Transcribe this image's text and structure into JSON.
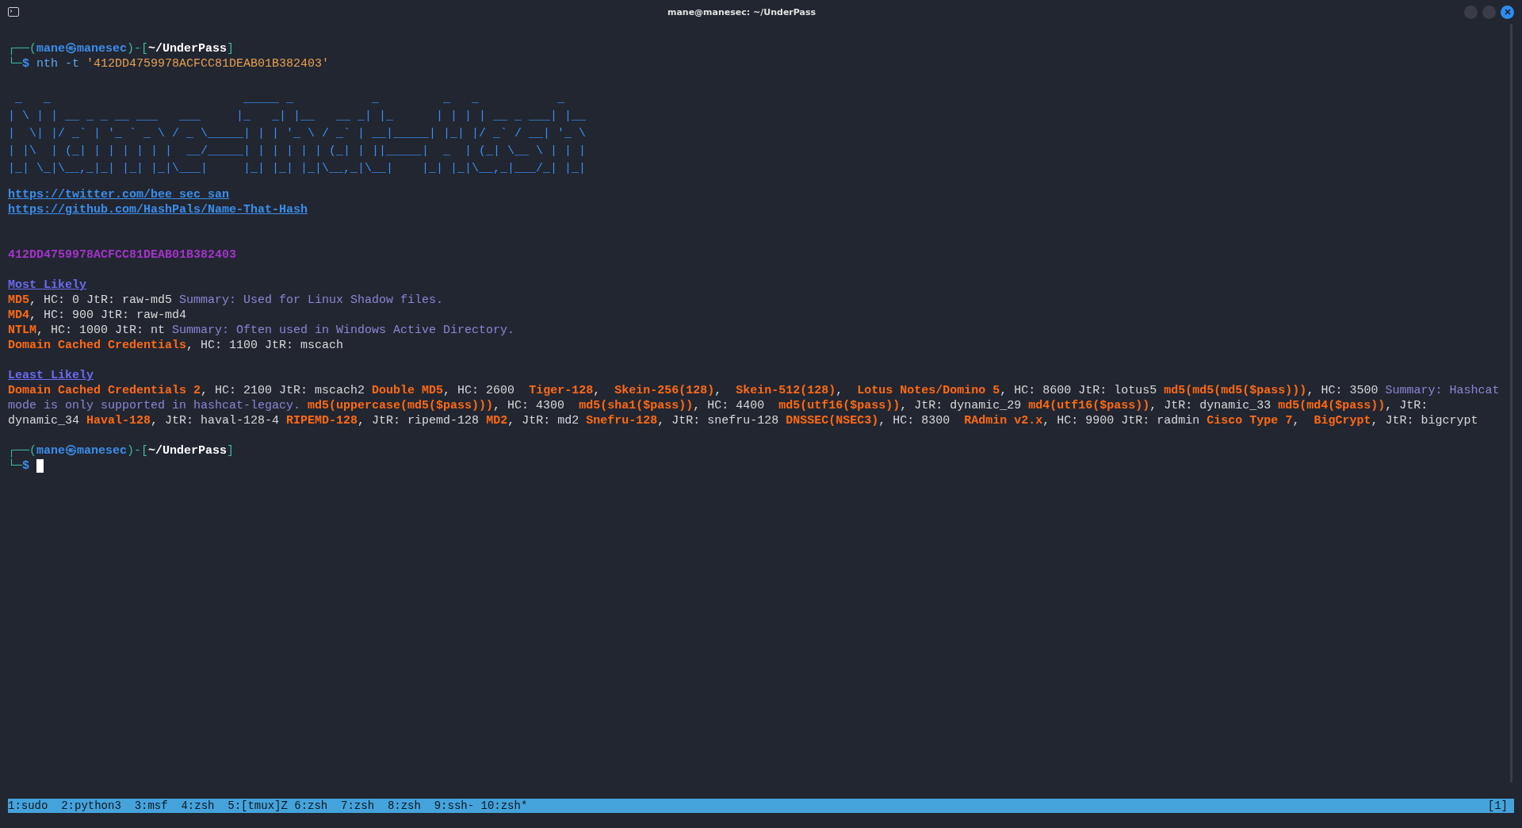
{
  "window": {
    "title": "mane@manesec: ~/UnderPass"
  },
  "terminal": [
    {
      "kind": "prompt",
      "lines": [
        [
          {
            "kind": "frame",
            "text": "┌──("
          },
          {
            "kind": "user",
            "text": "mane㉿manesec"
          },
          {
            "kind": "frame",
            "text": ")-["
          },
          {
            "kind": "path",
            "text": "~/UnderPass"
          },
          {
            "kind": "frame",
            "text": "]"
          }
        ],
        [
          {
            "kind": "frame",
            "text": "└─"
          },
          {
            "kind": "symbol",
            "text": "$"
          },
          {
            "kind": "command",
            "text": " nth -t "
          },
          {
            "kind": "argument",
            "text": "'412DD4759978ACFCC81DEAB01B382403'"
          }
        ]
      ]
    },
    {
      "kind": "art",
      "lines": [
        " _   _                           _____ _           _         _   _           _     ",
        "| \\ | | __ _ _ __ ___   ___     |_   _| |__   __ _| |_      | | | | __ _ ___| |__  ",
        "|  \\| |/ _` | '_ ` _ \\ / _ \\_____| | | '_ \\ / _` | __|_____| |_| |/ _` / __| '_ \\ ",
        "| |\\  | (_| | | | | | |  __/_____| | | | | | (_| | ||_____|  _  | (_| \\__ \\ | | |",
        "|_| \\_|\\__,_|_| |_| |_|\\___|     |_| |_| |_|\\__,_|\\__|    |_| |_|\\__,_|___/_| |_|"
      ]
    },
    {
      "kind": "links",
      "items": [
        "https://twitter.com/bee_sec_san",
        "https://github.com/HashPals/Name-That-Hash"
      ]
    },
    {
      "kind": "hash",
      "text": "412DD4759978ACFCC81DEAB01B382403"
    },
    {
      "kind": "section",
      "heading": "Most Likely",
      "results": [
        [
          {
            "kind": "name",
            "text": "MD5"
          },
          {
            "kind": "plain",
            "text": ", HC: 0 JtR: raw-md5 "
          },
          {
            "kind": "summary",
            "text": "Summary: Used for Linux Shadow files."
          }
        ],
        [
          {
            "kind": "name",
            "text": "MD4"
          },
          {
            "kind": "plain",
            "text": ", HC: 900 JtR: raw-md4"
          }
        ],
        [
          {
            "kind": "name",
            "text": "NTLM"
          },
          {
            "kind": "plain",
            "text": ", HC: 1000 JtR: nt "
          },
          {
            "kind": "summary",
            "text": "Summary: Often used in Windows Active Directory."
          }
        ],
        [
          {
            "kind": "name",
            "text": "Domain Cached Credentials"
          },
          {
            "kind": "plain",
            "text": ", HC: 1100 JtR: mscach"
          }
        ]
      ]
    },
    {
      "kind": "section",
      "heading": "Least Likely",
      "results": [
        [
          {
            "kind": "name",
            "text": "Domain Cached Credentials 2"
          },
          {
            "kind": "plain",
            "text": ", HC: 2100 JtR: mscach2 "
          },
          {
            "kind": "name",
            "text": "Double MD5"
          },
          {
            "kind": "plain",
            "text": ", HC: 2600  "
          },
          {
            "kind": "name",
            "text": "Tiger-128"
          },
          {
            "kind": "plain",
            "text": ",  "
          },
          {
            "kind": "name",
            "text": "Skein-256(128)"
          },
          {
            "kind": "plain",
            "text": ",  "
          },
          {
            "kind": "name",
            "text": "Skein-512(128)"
          },
          {
            "kind": "plain",
            "text": ",  "
          },
          {
            "kind": "name",
            "text": "Lotus Notes/Domino 5"
          },
          {
            "kind": "plain",
            "text": ", HC: 8600 JtR: lotus5 "
          },
          {
            "kind": "name",
            "text": "md5(md5(md5($pass)))"
          },
          {
            "kind": "plain",
            "text": ", HC: 3500 "
          },
          {
            "kind": "summary",
            "text": "Summary: Hashcat mode is only supported in hashcat-legacy. "
          },
          {
            "kind": "name",
            "text": "md5(uppercase(md5($pass)))"
          },
          {
            "kind": "plain",
            "text": ", HC: 4300  "
          },
          {
            "kind": "name",
            "text": "md5(sha1($pass))"
          },
          {
            "kind": "plain",
            "text": ", HC: 4400  "
          },
          {
            "kind": "name",
            "text": "md5(utf16($pass))"
          },
          {
            "kind": "plain",
            "text": ", JtR: dynamic_29 "
          },
          {
            "kind": "name",
            "text": "md4(utf16($pass))"
          },
          {
            "kind": "plain",
            "text": ", JtR: dynamic_33 "
          },
          {
            "kind": "name",
            "text": "md5(md4($pass))"
          },
          {
            "kind": "plain",
            "text": ", JtR: dynamic_34 "
          },
          {
            "kind": "name",
            "text": "Haval-128"
          },
          {
            "kind": "plain",
            "text": ", JtR: haval-128-4 "
          },
          {
            "kind": "name",
            "text": "RIPEMD-128"
          },
          {
            "kind": "plain",
            "text": ", JtR: ripemd-128 "
          },
          {
            "kind": "name",
            "text": "MD2"
          },
          {
            "kind": "plain",
            "text": ", JtR: md2 "
          },
          {
            "kind": "name",
            "text": "Snefru-128"
          },
          {
            "kind": "plain",
            "text": ", JtR: snefru-128 "
          },
          {
            "kind": "name",
            "text": "DNSSEC(NSEC3)"
          },
          {
            "kind": "plain",
            "text": ", HC: 8300  "
          },
          {
            "kind": "name",
            "text": "RAdmin v2.x"
          },
          {
            "kind": "plain",
            "text": ", HC: 9900 JtR: radmin "
          },
          {
            "kind": "name",
            "text": "Cisco Type 7"
          },
          {
            "kind": "plain",
            "text": ",  "
          },
          {
            "kind": "name",
            "text": "BigCrypt"
          },
          {
            "kind": "plain",
            "text": ", JtR: bigcrypt"
          }
        ]
      ]
    },
    {
      "kind": "prompt",
      "lines": [
        [
          {
            "kind": "frame",
            "text": "┌──("
          },
          {
            "kind": "user",
            "text": "mane㉿manesec"
          },
          {
            "kind": "frame",
            "text": ")-["
          },
          {
            "kind": "path",
            "text": "~/UnderPass"
          },
          {
            "kind": "frame",
            "text": "]"
          }
        ],
        [
          {
            "kind": "frame",
            "text": "└─"
          },
          {
            "kind": "symbol",
            "text": "$"
          }
        ]
      ],
      "cursor": true
    }
  ],
  "status_bar": {
    "windows": "1:sudo  2:python3  3:msf  4:zsh  5:[tmux]Z 6:zsh  7:zsh  8:zsh  9:ssh- 10:zsh*",
    "session": "[1]"
  }
}
